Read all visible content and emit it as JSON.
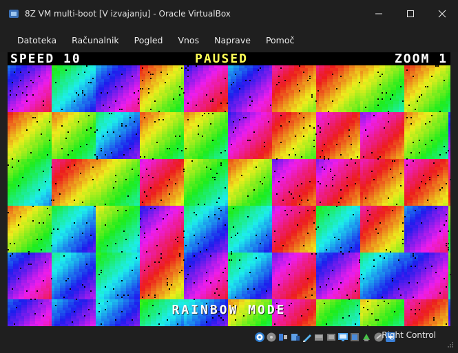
{
  "window": {
    "title": "8Z VM multi-boot [V izvajanju] - Oracle VirtualBox",
    "controls": [
      "minimize-icon",
      "maximize-icon",
      "close-icon"
    ]
  },
  "menu": {
    "items": [
      "Datoteka",
      "Računalnik",
      "Pogled",
      "Vnos",
      "Naprave",
      "Pomoč"
    ]
  },
  "vm_screen": {
    "speed_label": "SPEED 10",
    "status_label": "PAUSED",
    "zoom_label": "ZOOM 1",
    "mode_label": "RAINBOW MODE",
    "colors": {
      "hud_text": "#ffffff",
      "paused_text": "#ffff55"
    }
  },
  "statusbar": {
    "icons": [
      "optical-drive-icon",
      "floppy-icon",
      "usb-icon",
      "shared-folder-icon",
      "display-icon",
      "hard-disk-icon",
      "network-icon",
      "video-capture-icon",
      "cpu-icon",
      "mouse-integration-icon",
      "keyboard-icon"
    ],
    "host_key_label": "Right Control"
  }
}
